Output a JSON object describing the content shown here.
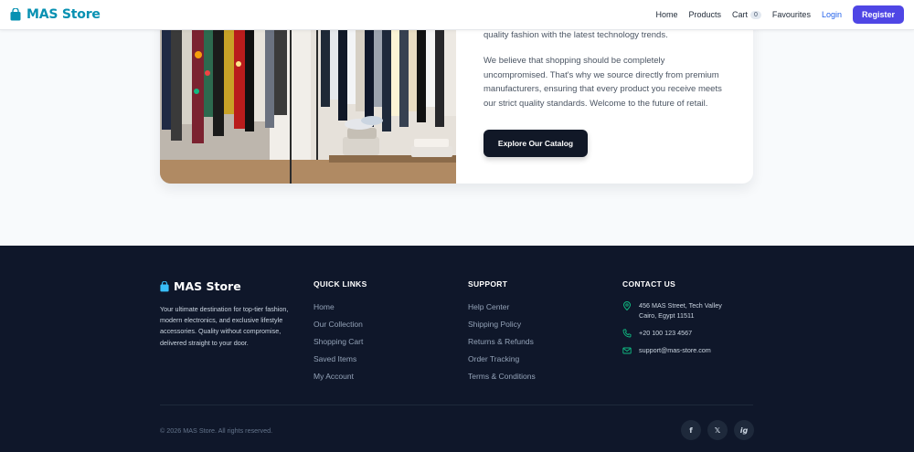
{
  "navbar": {
    "brand": "MAS Store",
    "links": {
      "home": "Home",
      "products": "Products",
      "cart": "Cart",
      "favourites": "Favourites",
      "login": "Login"
    },
    "cart_count": "0",
    "register": "Register",
    "colors": {
      "brand": "#0891b2",
      "register_bg": "#4f46e5",
      "login": "#2563eb"
    }
  },
  "about": {
    "line_top": "quality fashion with the latest technology trends.",
    "paragraph": "We believe that shopping should be completely uncompromised. That's why we source directly from premium manufacturers, ensuring that every product you receive meets our strict quality standards. Welcome to the future of retail.",
    "cta": "Explore Our Catalog",
    "image_icon": "clothing-store-photo"
  },
  "footer": {
    "brand": "MAS Store",
    "description": "Your ultimate destination for top-tier fashion, modern electronics, and exclusive lifestyle accessories. Quality without compromise, delivered straight to your door.",
    "quick_links": {
      "title": "QUICK LINKS",
      "items": [
        "Home",
        "Our Collection",
        "Shopping Cart",
        "Saved Items",
        "My Account"
      ]
    },
    "support": {
      "title": "SUPPORT",
      "items": [
        "Help Center",
        "Shipping Policy",
        "Returns & Refunds",
        "Order Tracking",
        "Terms & Conditions"
      ]
    },
    "contact": {
      "title": "CONTACT US",
      "address_line1": "456 MAS Street, Tech Valley",
      "address_line2": "Cairo, Egypt 11511",
      "phone": "+20 100 123 4567",
      "email": "support@mas-store.com",
      "icon_color": "#10b981"
    },
    "copyright": "© 2026 MAS Store. All rights reserved.",
    "social": {
      "facebook": "f",
      "x": "𝕏",
      "instagram": "ig"
    },
    "colors": {
      "background": "#0f172a"
    }
  }
}
